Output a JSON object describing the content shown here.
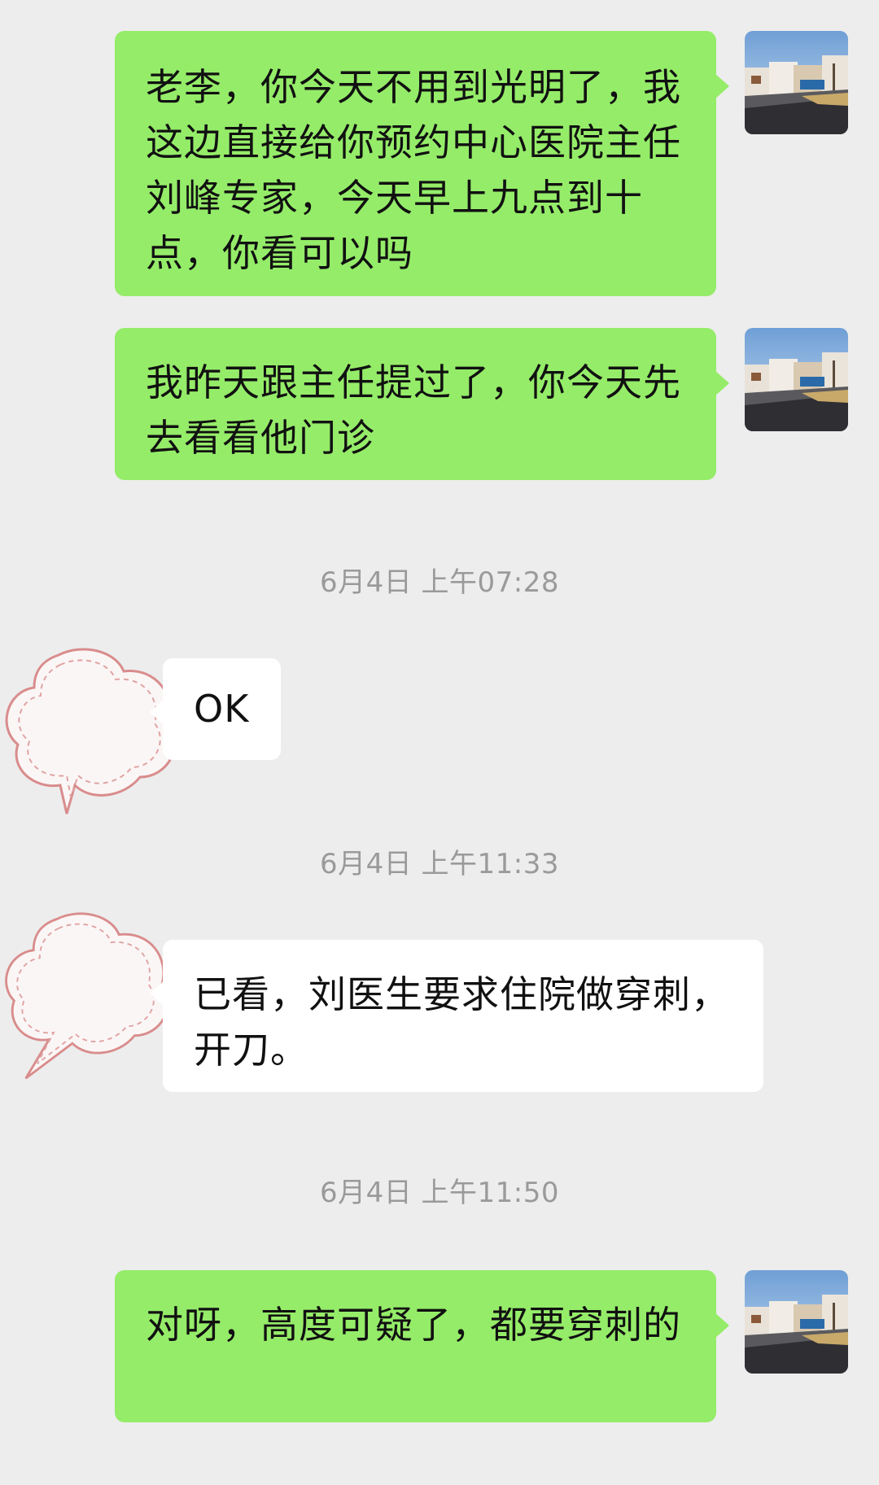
{
  "colors": {
    "background": "#ededed",
    "outgoing_bubble": "#95ec69",
    "incoming_bubble": "#ffffff",
    "timestamp_text": "#9a9a9a"
  },
  "messages": [
    {
      "direction": "outgoing",
      "text": "老李，你今天不用到光明了，我这边直接给你预约中心医院主任刘峰专家，今天早上九点到十点，你看可以吗"
    },
    {
      "direction": "outgoing",
      "text": "我昨天跟主任提过了，你今天先去看看他门诊"
    },
    {
      "timestamp": "6月4日 上午07:28"
    },
    {
      "direction": "incoming",
      "text": "OK"
    },
    {
      "timestamp": "6月4日 上午11:33"
    },
    {
      "direction": "incoming",
      "text": "已看，刘医生要求住院做穿刺，开刀。"
    },
    {
      "timestamp": "6月4日 上午11:50"
    },
    {
      "direction": "outgoing",
      "text": "对呀，高度可疑了，都要穿刺的"
    }
  ],
  "avatars": {
    "self": "street-photo-avatar",
    "contact": "cloud-sticker-avatar"
  }
}
